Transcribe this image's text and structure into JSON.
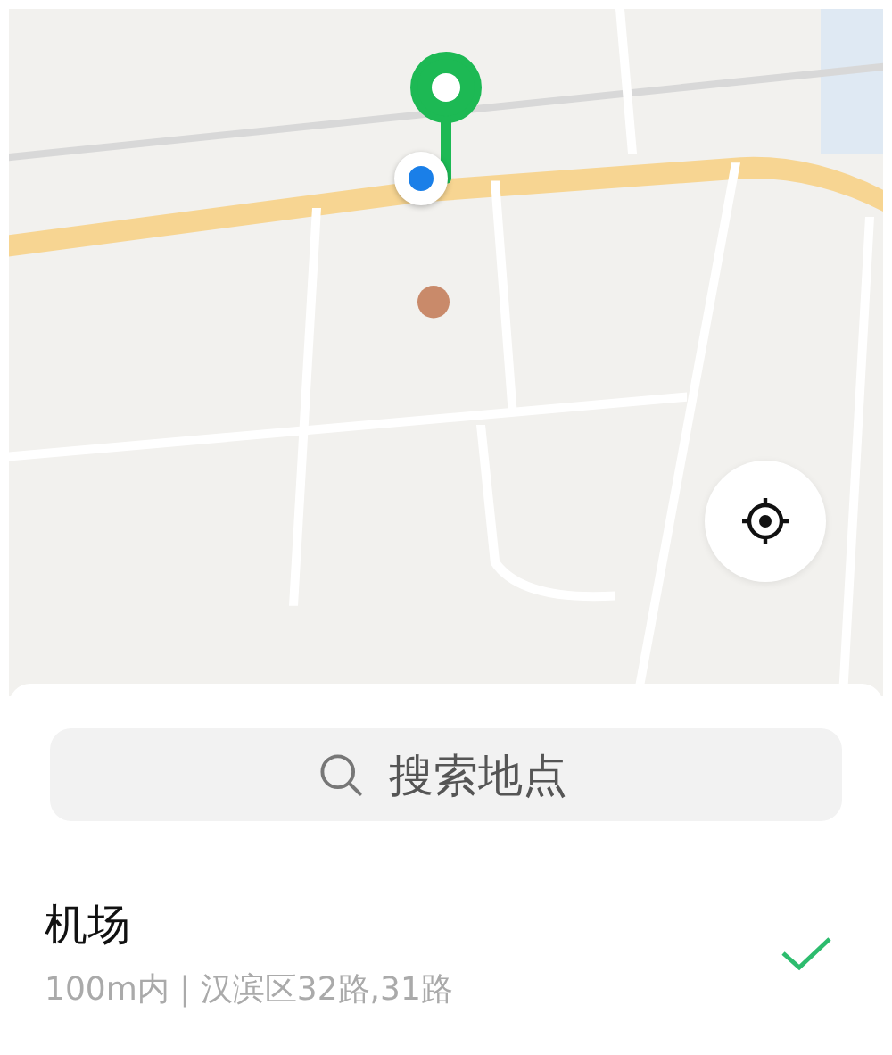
{
  "search": {
    "placeholder": "搜索地点"
  },
  "places": [
    {
      "name": "机场",
      "detail": "100m内 | 汉滨区32路,31路",
      "selected": true
    }
  ]
}
